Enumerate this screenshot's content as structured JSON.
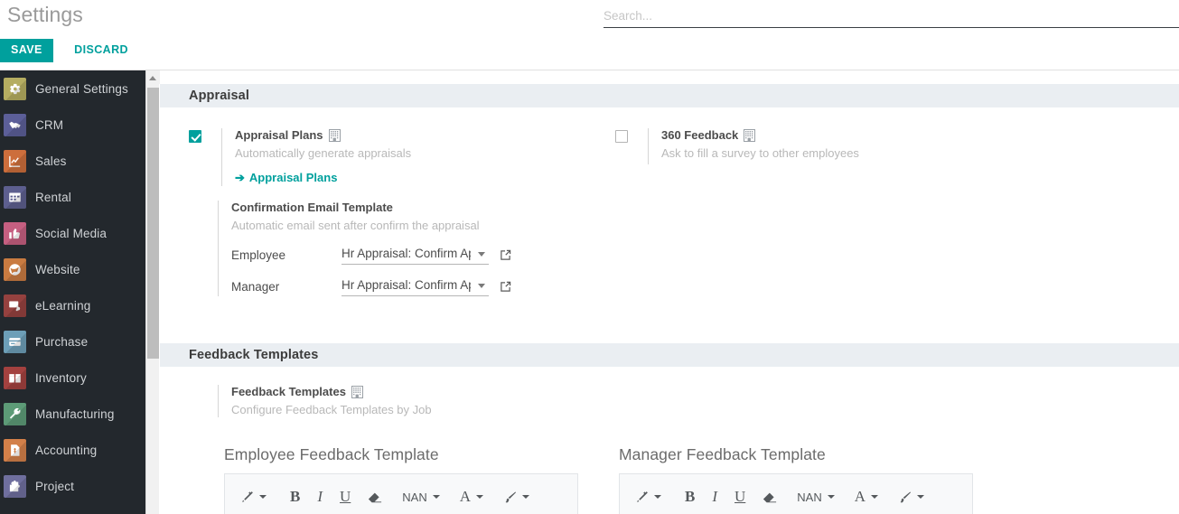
{
  "header": {
    "title": "Settings",
    "save_label": "SAVE",
    "discard_label": "DISCARD"
  },
  "search": {
    "placeholder": "Search...",
    "value": ""
  },
  "sidebar": {
    "items": [
      {
        "label": "General Settings",
        "icon": "gear-icon",
        "color": "#b5ad61"
      },
      {
        "label": "CRM",
        "icon": "handshake-icon",
        "color": "#5c5f99"
      },
      {
        "label": "Sales",
        "icon": "chart-line-icon",
        "color": "#cd6e3c"
      },
      {
        "label": "Rental",
        "icon": "calendar-icon",
        "color": "#5d5f8f"
      },
      {
        "label": "Social Media",
        "icon": "thumbs-up-icon",
        "color": "#c55f81"
      },
      {
        "label": "Website",
        "icon": "globe-icon",
        "color": "#c97b41"
      },
      {
        "label": "eLearning",
        "icon": "presentation-icon",
        "color": "#95413f"
      },
      {
        "label": "Purchase",
        "icon": "card-icon",
        "color": "#6d9fb8"
      },
      {
        "label": "Inventory",
        "icon": "box-icon",
        "color": "#a3413f"
      },
      {
        "label": "Manufacturing",
        "icon": "wrench-icon",
        "color": "#5d9b77"
      },
      {
        "label": "Accounting",
        "icon": "invoice-icon",
        "color": "#d38049"
      },
      {
        "label": "Project",
        "icon": "puzzle-icon",
        "color": "#6f6f9e"
      }
    ]
  },
  "sections": {
    "appraisal": {
      "heading": "Appraisal",
      "appraisal_plans": {
        "checked": true,
        "title": "Appraisal Plans",
        "badge_icon": "enterprise-icon",
        "description": "Automatically generate appraisals",
        "link_label": "Appraisal Plans",
        "link_arrow": "➔"
      },
      "feedback_360": {
        "checked": false,
        "title": "360 Feedback",
        "badge_icon": "enterprise-icon",
        "description": "Ask to fill a survey to other employees"
      },
      "confirmation_email": {
        "title": "Confirmation Email Template",
        "description": "Automatic email sent after confirm the appraisal",
        "fields": [
          {
            "label": "Employee",
            "value": "Hr Appraisal: Confirm Appraisal",
            "external_icon": "external-link-icon"
          },
          {
            "label": "Manager",
            "value": "Hr Appraisal: Confirm Appraisal",
            "external_icon": "external-link-icon"
          }
        ]
      }
    },
    "feedback_templates": {
      "heading": "Feedback Templates",
      "block": {
        "title": "Feedback Templates",
        "badge_icon": "enterprise-icon",
        "description": "Configure Feedback Templates by Job"
      },
      "editors": [
        {
          "title": "Employee Feedback Template",
          "toolbar": {
            "style_icon": "magic-wand-icon",
            "bold": "B",
            "italic": "I",
            "underline": "U",
            "eraser_icon": "eraser-icon",
            "font_size": "NAN",
            "font_color": "A",
            "highlight_icon": "paint-brush-icon"
          }
        },
        {
          "title": "Manager Feedback Template",
          "toolbar": {
            "style_icon": "magic-wand-icon",
            "bold": "B",
            "italic": "I",
            "underline": "U",
            "eraser_icon": "eraser-icon",
            "font_size": "NAN",
            "font_color": "A",
            "highlight_icon": "paint-brush-icon"
          }
        }
      ]
    }
  },
  "colors": {
    "accent": "#00A09D",
    "sidebar_bg": "#23282d",
    "section_header_bg": "#eaeef2",
    "muted_text": "#b8b8b8"
  }
}
